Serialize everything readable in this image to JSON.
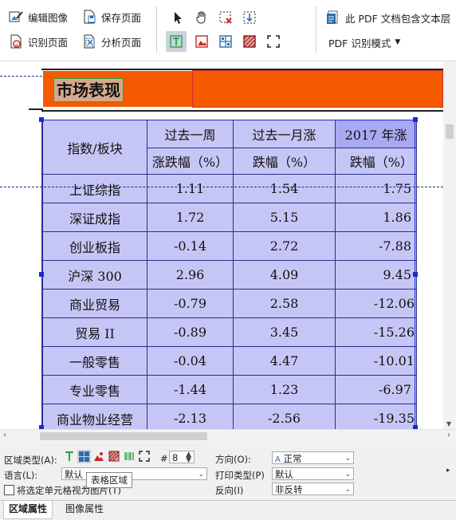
{
  "toolbar": {
    "edit_image": "编辑图像",
    "save_page": "保存页面",
    "recognize_page": "识别页面",
    "analyze_page": "分析页面",
    "pdf_contains_text": "此 PDF 文档包含文本层",
    "pdf_recognition_mode": "PDF 识别模式"
  },
  "document": {
    "section_title": "市场表现",
    "header_row1": [
      "指数/板块",
      "过去一周",
      "过去一月涨",
      "2017 年涨"
    ],
    "header_row2": [
      "涨跌幅（%）",
      "跌幅（%）",
      "跌幅（%）"
    ],
    "rows": [
      [
        "上证综指",
        "1.11",
        "1.54",
        "1.75"
      ],
      [
        "深证成指",
        "1.72",
        "5.15",
        "1.86"
      ],
      [
        "创业板指",
        "-0.14",
        "2.72",
        "-7.88"
      ],
      [
        "沪深 300",
        "2.96",
        "4.09",
        "9.45"
      ],
      [
        "商业贸易",
        "-0.79",
        "2.58",
        "-12.06"
      ],
      [
        "贸易 II",
        "-0.89",
        "3.45",
        "-15.26"
      ],
      [
        "一般零售",
        "-0.04",
        "4.47",
        "-10.01"
      ],
      [
        "专业零售",
        "-1.44",
        "1.23",
        "-6.97"
      ],
      [
        "商业物业经营",
        "-2.13",
        "-2.56",
        "-19.35"
      ]
    ]
  },
  "props": {
    "region_type_label": "区域类型(A):",
    "cell_count": "8",
    "language_label": "语言(L):",
    "language_value": "默认",
    "treat_cells_as_images": "将选定单元格视为图片(T)",
    "tooltip": "表格区域",
    "orientation_label": "方向(O):",
    "orientation_value": "正常",
    "print_type_label": "打印类型(P)",
    "print_type_value": "默认",
    "invert_label": "反向(I)",
    "invert_value": "非反转"
  },
  "tabs": [
    "区域属性",
    "图像属性"
  ],
  "colors": {
    "table_fill": "#c6c6f6",
    "table_border": "#2a2f8a",
    "header_bar": "#f55a00",
    "title_box": "#d4a98c"
  }
}
